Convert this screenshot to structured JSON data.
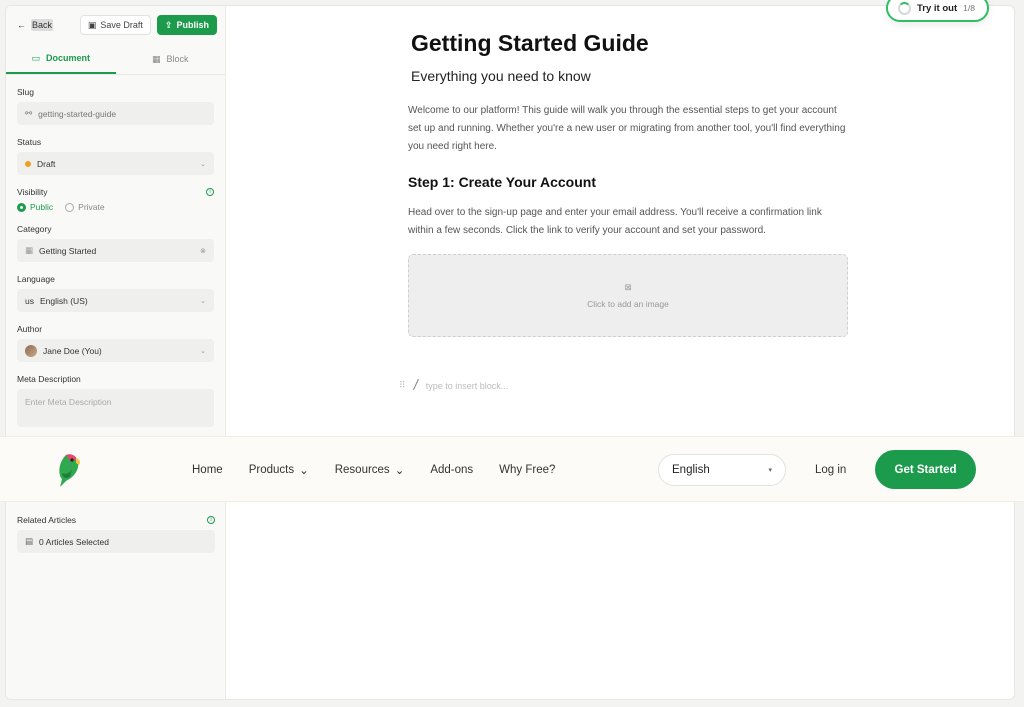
{
  "toolbar": {
    "back_label": "Back",
    "save_label": "Save Draft",
    "publish_label": "Publish"
  },
  "tabs": {
    "document": "Document",
    "block": "Block"
  },
  "fields": {
    "slug_label": "Slug",
    "slug_value": "getting-started-guide",
    "status_label": "Status",
    "status_value": "Draft",
    "visibility_label": "Visibility",
    "visibility_public": "Public",
    "visibility_private": "Private",
    "category_label": "Category",
    "category_value": "Getting Started",
    "language_label": "Language",
    "language_prefix": "us",
    "language_value": "English (US)",
    "author_label": "Author",
    "author_value": "Jane Doe (You)",
    "meta_label": "Meta Description",
    "meta_placeholder": "Enter Meta Description",
    "related_label": "Related Articles",
    "related_value": "0 Articles Selected"
  },
  "editor": {
    "title": "Getting Started Guide",
    "subtitle": "Everything you need to know",
    "intro": "Welcome to our platform! This guide will walk you through the essential steps to get your account set up and running. Whether you're a new user or migrating from another tool, you'll find everything you need right here.",
    "step1_title": "Step 1: Create Your Account",
    "step1_body": "Head over to the sign-up page and enter your email address. You'll receive a confirmation link within a few seconds. Click the link to verify your account and set your password.",
    "image_placeholder": "Click to add an image",
    "insert_placeholder": "type to insert block..."
  },
  "tryit": {
    "label": "Try it out",
    "count": "1/8"
  },
  "navbar": {
    "items": [
      "Home",
      "Products",
      "Resources",
      "Add-ons",
      "Why Free?"
    ],
    "language": "English",
    "login": "Log in",
    "cta": "Get Started"
  },
  "colors": {
    "accent": "#1c9b4c",
    "status_draft": "#f0a020"
  }
}
